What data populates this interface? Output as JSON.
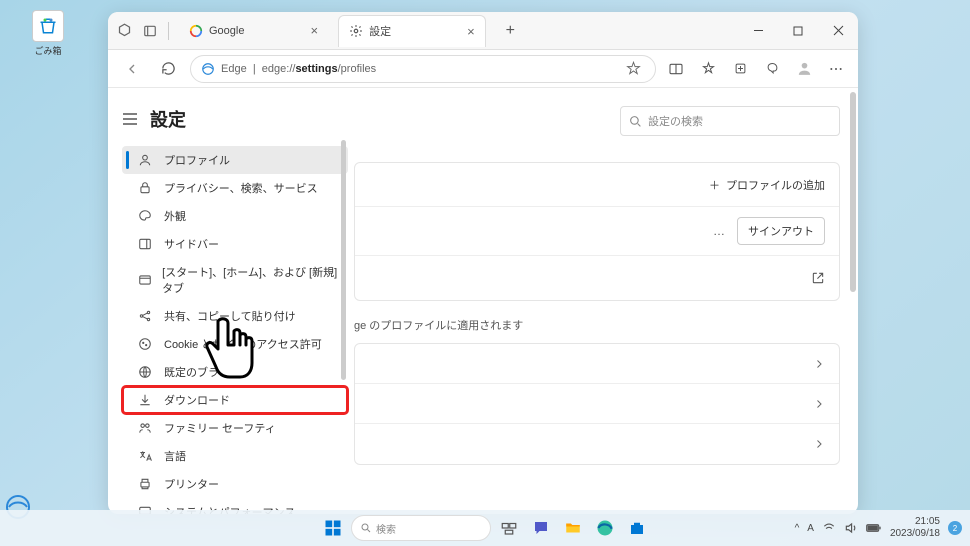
{
  "desktop": {
    "recycle_bin_label": "ごみ箱"
  },
  "browser": {
    "tabs": [
      {
        "label": "Google",
        "favicon": "google"
      },
      {
        "label": "設定",
        "favicon": "gear"
      }
    ],
    "url_prefix": "Edge",
    "url_path_pre": "edge://",
    "url_path_bold": "settings",
    "url_path_post": "/profiles"
  },
  "settings": {
    "title": "設定",
    "search_placeholder": "設定の検索",
    "sidebar": [
      {
        "icon": "user",
        "label": "プロファイル"
      },
      {
        "icon": "lock",
        "label": "プライバシー、検索、サービス"
      },
      {
        "icon": "appearance",
        "label": "外観"
      },
      {
        "icon": "sidebar",
        "label": "サイドバー"
      },
      {
        "icon": "tab",
        "label": "[スタート]、[ホーム]、および [新規] タブ"
      },
      {
        "icon": "share",
        "label": "共有、コピーして貼り付け"
      },
      {
        "icon": "cookie",
        "label": "Cookie とサイトのアクセス許可"
      },
      {
        "icon": "browser",
        "label": "既定のブラウザー"
      },
      {
        "icon": "download",
        "label": "ダウンロード"
      },
      {
        "icon": "family",
        "label": "ファミリー セーフティ"
      },
      {
        "icon": "language",
        "label": "言語"
      },
      {
        "icon": "printer",
        "label": "プリンター"
      },
      {
        "icon": "system",
        "label": "システムとパフォーマンス"
      }
    ],
    "add_profile_label": "プロファイルの追加",
    "signout_label": "サインアウト",
    "sync_note_fragment": "ge のプロファイルに適用されます"
  },
  "taskbar": {
    "search_placeholder": "検索",
    "clock_time": "21:05",
    "clock_date": "2023/09/18",
    "notification_count": "2",
    "ime_indicator": "A",
    "chevron": "^"
  }
}
